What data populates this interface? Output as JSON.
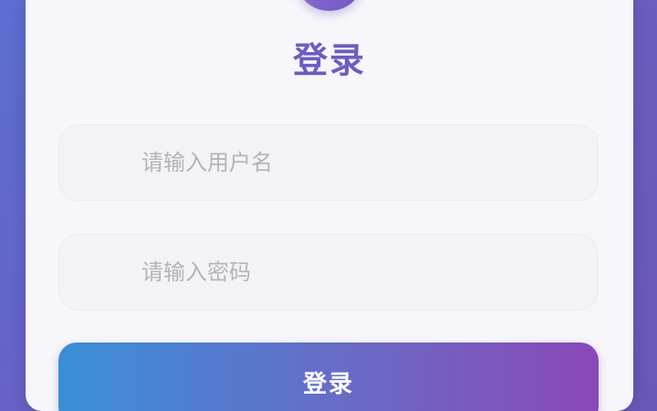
{
  "login": {
    "title": "登录",
    "username_placeholder": "请输入用户名",
    "password_placeholder": "请输入密码",
    "submit_label": "登录"
  },
  "icons": {
    "avatar": "avatar-icon",
    "username": "user-icon",
    "password": "lock-icon"
  },
  "colors": {
    "background_gradient": [
      "#5b6fd0",
      "#6b57b8"
    ],
    "title": "#6e5cc0",
    "button_gradient": [
      "#3a8fd6",
      "#8a48b8"
    ],
    "placeholder": "#b4b4b8"
  }
}
